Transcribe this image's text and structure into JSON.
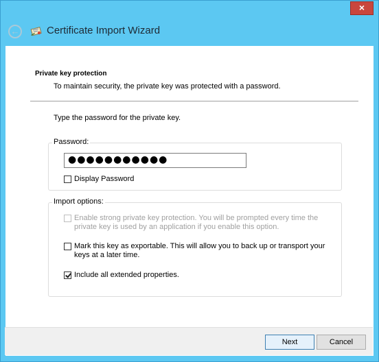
{
  "window": {
    "title": "Certificate Import Wizard",
    "close_glyph": "×",
    "back_glyph": "←",
    "accent_color": "#5cc8f2"
  },
  "content": {
    "section_title": "Private key protection",
    "section_desc": "To maintain security, the private key was protected with a password.",
    "prompt": "Type the password for the private key."
  },
  "password_group": {
    "label": "Password:",
    "value": "●●●●●●●●●●●",
    "display_password_label": "Display Password",
    "display_password_checked": false
  },
  "import_options": {
    "label": "Import options:",
    "strong_protection_line1": "Enable strong private key protection. You will be prompted every time the",
    "strong_protection_line2": "private key is used by an application if you enable this option.",
    "exportable_line1": "Mark this key as exportable. This will allow you to back up or transport your",
    "exportable_line2": "keys at a later time.",
    "extended_properties_label": "Include all extended properties."
  },
  "footer": {
    "next_label": "Next",
    "cancel_label": "Cancel"
  }
}
